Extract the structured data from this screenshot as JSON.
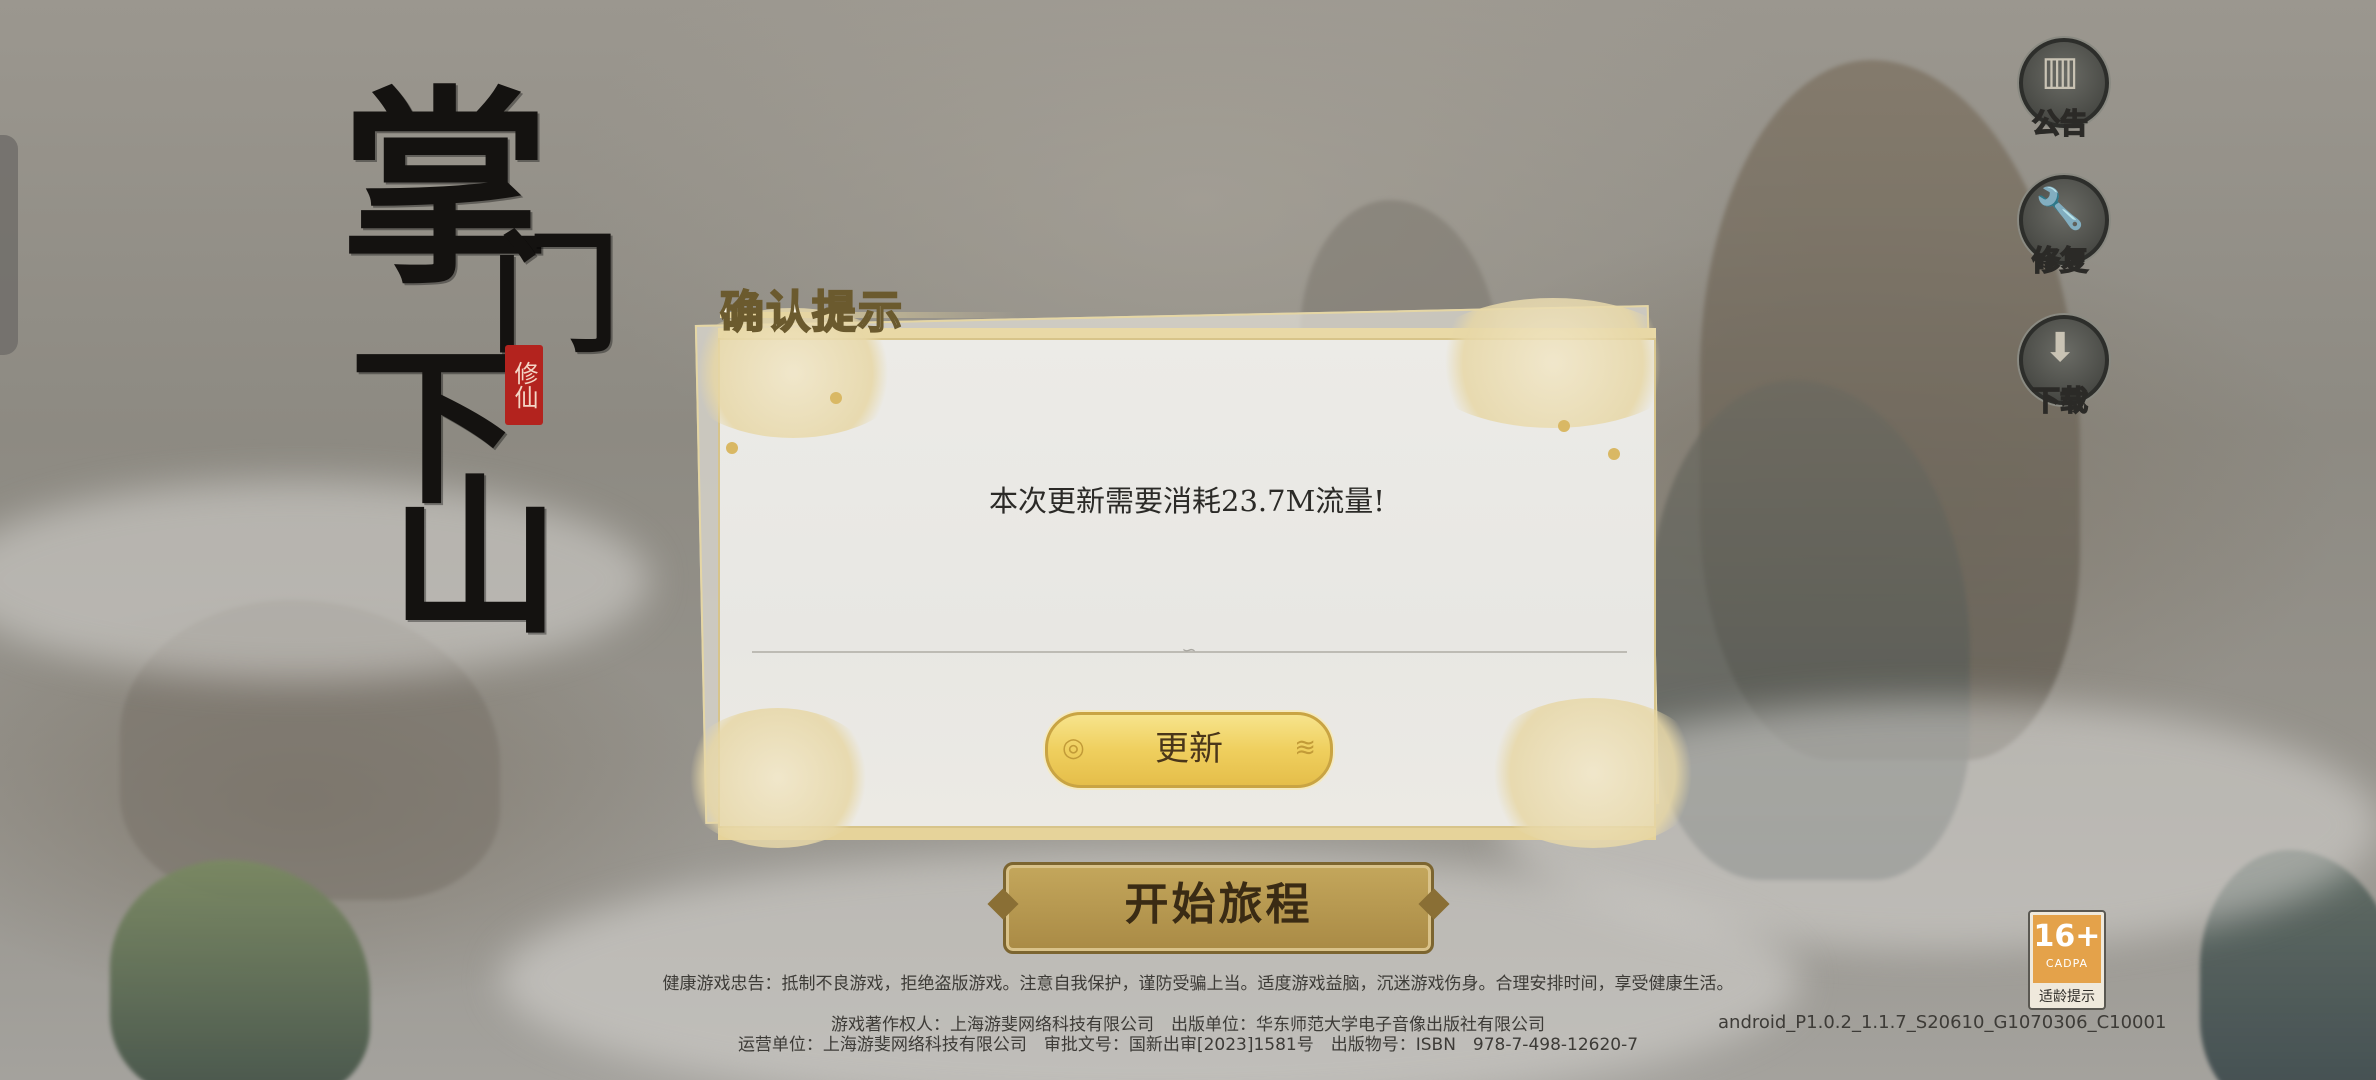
{
  "logo": {
    "line1": "掌",
    "line2": "门",
    "line3": "下",
    "line4": "山",
    "seal": "修仙"
  },
  "side_buttons": [
    {
      "icon": "notice-board-icon",
      "glyph": "▥",
      "label": "公告"
    },
    {
      "icon": "wrench-icon",
      "glyph": "🔧",
      "label": "修复"
    },
    {
      "icon": "download-icon",
      "glyph": "⬇",
      "label": "下载"
    }
  ],
  "dialog": {
    "title": "确认提示",
    "message": "本次更新需要消耗23.7M流量!",
    "update_label": "更新"
  },
  "start_button": {
    "label": "开始旅程"
  },
  "footer": {
    "health_notice": "健康游戏忠告：抵制不良游戏，拒绝盗版游戏。注意自我保护，谨防受骗上当。适度游戏益脑，沉迷游戏伤身。合理安排时间，享受健康生活。",
    "copyright": "游戏著作权人：上海游斐网络科技有限公司　出版单位：华东师范大学电子音像出版社有限公司",
    "operator": "运营单位：上海游斐网络科技有限公司　审批文号：国新出审[2023]1581号　出版物号：ISBN　978-7-498-12620-7",
    "version": "android_P1.0.2_1.1.7_S20610_G1070306_C10001"
  },
  "age_rating": {
    "number": "16+",
    "org": "CADPA",
    "caption": "适龄提示",
    "color": "#e4a24a"
  }
}
